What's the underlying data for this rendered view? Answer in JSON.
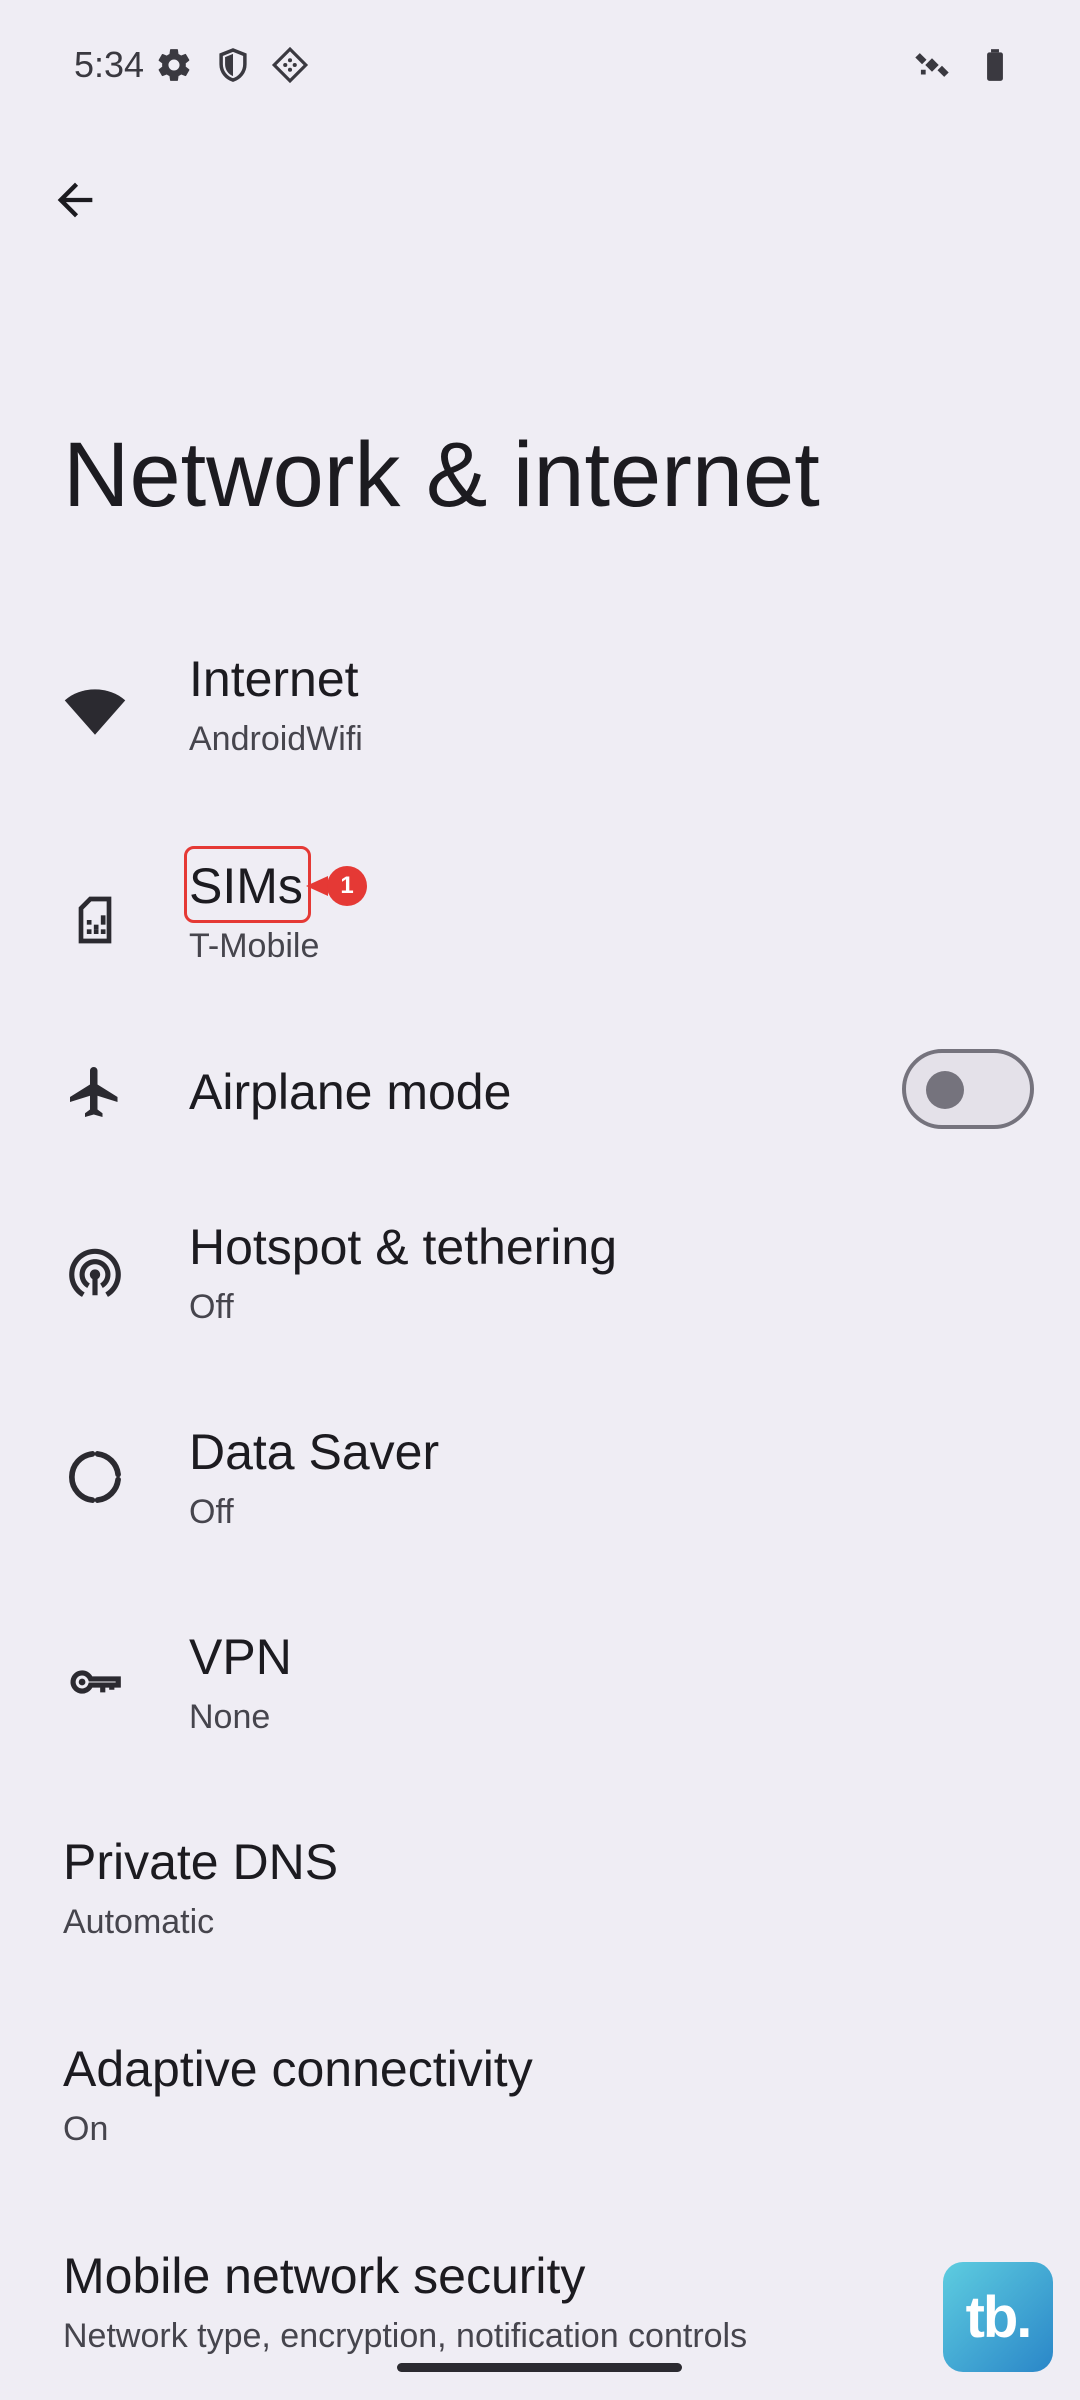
{
  "status_bar": {
    "time": "5:34",
    "left_icons": [
      "gear-icon",
      "shield-icon",
      "network-diamond-icon"
    ],
    "right_icons": [
      "satellite-icon",
      "battery-icon"
    ]
  },
  "header": {
    "title": "Network & internet"
  },
  "items": [
    {
      "title": "Internet",
      "subtitle": "AndroidWifi",
      "icon": "wifi-icon"
    },
    {
      "title": "SIMs",
      "subtitle": "T-Mobile",
      "icon": "sim-card-icon"
    },
    {
      "title": "Airplane mode",
      "icon": "airplane-icon",
      "toggle_on": false
    },
    {
      "title": "Hotspot & tethering",
      "subtitle": "Off",
      "icon": "hotspot-icon"
    },
    {
      "title": "Data Saver",
      "subtitle": "Off",
      "icon": "data-saver-icon"
    },
    {
      "title": "VPN",
      "subtitle": "None",
      "icon": "key-icon"
    },
    {
      "title": "Private DNS",
      "subtitle": "Automatic"
    },
    {
      "title": "Adaptive connectivity",
      "subtitle": "On"
    },
    {
      "title": "Mobile network security",
      "subtitle": "Network type, encryption, notification controls"
    }
  ],
  "annotation": {
    "badge": "1",
    "color": "#E53935"
  },
  "watermark": {
    "text": "tb."
  },
  "colors": {
    "background": "#EFEDF4",
    "text": "#1C1B20",
    "accent": "#E53935"
  }
}
